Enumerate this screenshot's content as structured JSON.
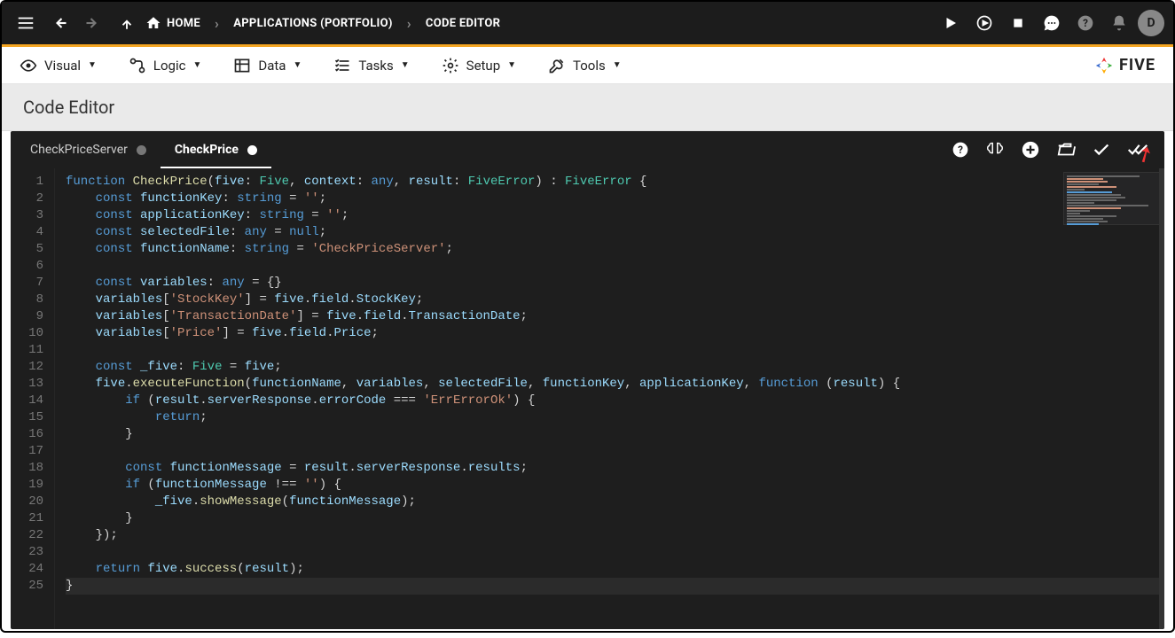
{
  "header": {
    "breadcrumbs": [
      "HOME",
      "APPLICATIONS (PORTFOLIO)",
      "CODE EDITOR"
    ],
    "avatar_letter": "D"
  },
  "subnav": {
    "items": [
      {
        "label": "Visual"
      },
      {
        "label": "Logic"
      },
      {
        "label": "Data"
      },
      {
        "label": "Tasks"
      },
      {
        "label": "Setup"
      },
      {
        "label": "Tools"
      }
    ],
    "brand": "FIVE"
  },
  "page": {
    "title": "Code Editor"
  },
  "editor": {
    "tabs": [
      {
        "label": "CheckPriceServer",
        "active": false
      },
      {
        "label": "CheckPrice",
        "active": true
      }
    ],
    "code_lines": [
      {
        "n": 1,
        "tokens": [
          {
            "t": "function",
            "c": "kw"
          },
          {
            "t": " "
          },
          {
            "t": "CheckPrice",
            "c": "fn"
          },
          {
            "t": "("
          },
          {
            "t": "five",
            "c": "prop"
          },
          {
            "t": ": "
          },
          {
            "t": "Five",
            "c": "type"
          },
          {
            "t": ", "
          },
          {
            "t": "context",
            "c": "prop"
          },
          {
            "t": ": "
          },
          {
            "t": "any",
            "c": "kw"
          },
          {
            "t": ", "
          },
          {
            "t": "result",
            "c": "prop"
          },
          {
            "t": ": "
          },
          {
            "t": "FiveError",
            "c": "type"
          },
          {
            "t": ") : "
          },
          {
            "t": "FiveError",
            "c": "type"
          },
          {
            "t": " {"
          }
        ]
      },
      {
        "n": 2,
        "tokens": [
          {
            "t": "    "
          },
          {
            "t": "const",
            "c": "kw"
          },
          {
            "t": " "
          },
          {
            "t": "functionKey",
            "c": "prop"
          },
          {
            "t": ": "
          },
          {
            "t": "string",
            "c": "kw"
          },
          {
            "t": " = "
          },
          {
            "t": "''",
            "c": "str"
          },
          {
            "t": ";"
          }
        ]
      },
      {
        "n": 3,
        "tokens": [
          {
            "t": "    "
          },
          {
            "t": "const",
            "c": "kw"
          },
          {
            "t": " "
          },
          {
            "t": "applicationKey",
            "c": "prop"
          },
          {
            "t": ": "
          },
          {
            "t": "string",
            "c": "kw"
          },
          {
            "t": " = "
          },
          {
            "t": "''",
            "c": "str"
          },
          {
            "t": ";"
          }
        ]
      },
      {
        "n": 4,
        "tokens": [
          {
            "t": "    "
          },
          {
            "t": "const",
            "c": "kw"
          },
          {
            "t": " "
          },
          {
            "t": "selectedFile",
            "c": "prop"
          },
          {
            "t": ": "
          },
          {
            "t": "any",
            "c": "kw"
          },
          {
            "t": " = "
          },
          {
            "t": "null",
            "c": "kw"
          },
          {
            "t": ";"
          }
        ]
      },
      {
        "n": 5,
        "tokens": [
          {
            "t": "    "
          },
          {
            "t": "const",
            "c": "kw"
          },
          {
            "t": " "
          },
          {
            "t": "functionName",
            "c": "prop"
          },
          {
            "t": ": "
          },
          {
            "t": "string",
            "c": "kw"
          },
          {
            "t": " = "
          },
          {
            "t": "'CheckPriceServer'",
            "c": "str"
          },
          {
            "t": ";"
          }
        ]
      },
      {
        "n": 6,
        "tokens": []
      },
      {
        "n": 7,
        "tokens": [
          {
            "t": "    "
          },
          {
            "t": "const",
            "c": "kw"
          },
          {
            "t": " "
          },
          {
            "t": "variables",
            "c": "prop"
          },
          {
            "t": ": "
          },
          {
            "t": "any",
            "c": "kw"
          },
          {
            "t": " = {}"
          }
        ]
      },
      {
        "n": 8,
        "tokens": [
          {
            "t": "    "
          },
          {
            "t": "variables",
            "c": "prop"
          },
          {
            "t": "["
          },
          {
            "t": "'StockKey'",
            "c": "str"
          },
          {
            "t": "] = "
          },
          {
            "t": "five",
            "c": "prop"
          },
          {
            "t": "."
          },
          {
            "t": "field",
            "c": "prop"
          },
          {
            "t": "."
          },
          {
            "t": "StockKey",
            "c": "prop"
          },
          {
            "t": ";"
          }
        ]
      },
      {
        "n": 9,
        "tokens": [
          {
            "t": "    "
          },
          {
            "t": "variables",
            "c": "prop"
          },
          {
            "t": "["
          },
          {
            "t": "'TransactionDate'",
            "c": "str"
          },
          {
            "t": "] = "
          },
          {
            "t": "five",
            "c": "prop"
          },
          {
            "t": "."
          },
          {
            "t": "field",
            "c": "prop"
          },
          {
            "t": "."
          },
          {
            "t": "TransactionDate",
            "c": "prop"
          },
          {
            "t": ";"
          }
        ]
      },
      {
        "n": 10,
        "tokens": [
          {
            "t": "    "
          },
          {
            "t": "variables",
            "c": "prop"
          },
          {
            "t": "["
          },
          {
            "t": "'Price'",
            "c": "str"
          },
          {
            "t": "] = "
          },
          {
            "t": "five",
            "c": "prop"
          },
          {
            "t": "."
          },
          {
            "t": "field",
            "c": "prop"
          },
          {
            "t": "."
          },
          {
            "t": "Price",
            "c": "prop"
          },
          {
            "t": ";"
          }
        ]
      },
      {
        "n": 11,
        "tokens": []
      },
      {
        "n": 12,
        "tokens": [
          {
            "t": "    "
          },
          {
            "t": "const",
            "c": "kw"
          },
          {
            "t": " "
          },
          {
            "t": "_five",
            "c": "prop"
          },
          {
            "t": ": "
          },
          {
            "t": "Five",
            "c": "type"
          },
          {
            "t": " = "
          },
          {
            "t": "five",
            "c": "prop"
          },
          {
            "t": ";"
          }
        ]
      },
      {
        "n": 13,
        "tokens": [
          {
            "t": "    "
          },
          {
            "t": "five",
            "c": "prop"
          },
          {
            "t": "."
          },
          {
            "t": "executeFunction",
            "c": "fn"
          },
          {
            "t": "("
          },
          {
            "t": "functionName",
            "c": "prop"
          },
          {
            "t": ", "
          },
          {
            "t": "variables",
            "c": "prop"
          },
          {
            "t": ", "
          },
          {
            "t": "selectedFile",
            "c": "prop"
          },
          {
            "t": ", "
          },
          {
            "t": "functionKey",
            "c": "prop"
          },
          {
            "t": ", "
          },
          {
            "t": "applicationKey",
            "c": "prop"
          },
          {
            "t": ", "
          },
          {
            "t": "function",
            "c": "kw"
          },
          {
            "t": " ("
          },
          {
            "t": "result",
            "c": "prop"
          },
          {
            "t": ") {"
          }
        ]
      },
      {
        "n": 14,
        "tokens": [
          {
            "t": "        "
          },
          {
            "t": "if",
            "c": "kw"
          },
          {
            "t": " ("
          },
          {
            "t": "result",
            "c": "prop"
          },
          {
            "t": "."
          },
          {
            "t": "serverResponse",
            "c": "prop"
          },
          {
            "t": "."
          },
          {
            "t": "errorCode",
            "c": "prop"
          },
          {
            "t": " === "
          },
          {
            "t": "'ErrErrorOk'",
            "c": "str"
          },
          {
            "t": ") {"
          }
        ]
      },
      {
        "n": 15,
        "tokens": [
          {
            "t": "            "
          },
          {
            "t": "return",
            "c": "kw"
          },
          {
            "t": ";"
          }
        ]
      },
      {
        "n": 16,
        "tokens": [
          {
            "t": "        }"
          }
        ]
      },
      {
        "n": 17,
        "tokens": []
      },
      {
        "n": 18,
        "tokens": [
          {
            "t": "        "
          },
          {
            "t": "const",
            "c": "kw"
          },
          {
            "t": " "
          },
          {
            "t": "functionMessage",
            "c": "prop"
          },
          {
            "t": " = "
          },
          {
            "t": "result",
            "c": "prop"
          },
          {
            "t": "."
          },
          {
            "t": "serverResponse",
            "c": "prop"
          },
          {
            "t": "."
          },
          {
            "t": "results",
            "c": "prop"
          },
          {
            "t": ";"
          }
        ]
      },
      {
        "n": 19,
        "tokens": [
          {
            "t": "        "
          },
          {
            "t": "if",
            "c": "kw"
          },
          {
            "t": " ("
          },
          {
            "t": "functionMessage",
            "c": "prop"
          },
          {
            "t": " !== "
          },
          {
            "t": "''",
            "c": "str"
          },
          {
            "t": ") {"
          }
        ]
      },
      {
        "n": 20,
        "tokens": [
          {
            "t": "            "
          },
          {
            "t": "_five",
            "c": "prop"
          },
          {
            "t": "."
          },
          {
            "t": "showMessage",
            "c": "fn"
          },
          {
            "t": "("
          },
          {
            "t": "functionMessage",
            "c": "prop"
          },
          {
            "t": ");"
          }
        ]
      },
      {
        "n": 21,
        "tokens": [
          {
            "t": "        }"
          }
        ]
      },
      {
        "n": 22,
        "tokens": [
          {
            "t": "    });"
          }
        ]
      },
      {
        "n": 23,
        "tokens": []
      },
      {
        "n": 24,
        "tokens": [
          {
            "t": "    "
          },
          {
            "t": "return",
            "c": "kw"
          },
          {
            "t": " "
          },
          {
            "t": "five",
            "c": "prop"
          },
          {
            "t": "."
          },
          {
            "t": "success",
            "c": "fn"
          },
          {
            "t": "("
          },
          {
            "t": "result",
            "c": "prop"
          },
          {
            "t": ");"
          }
        ]
      },
      {
        "n": 25,
        "hl": true,
        "tokens": [
          {
            "t": "}"
          }
        ]
      }
    ]
  }
}
